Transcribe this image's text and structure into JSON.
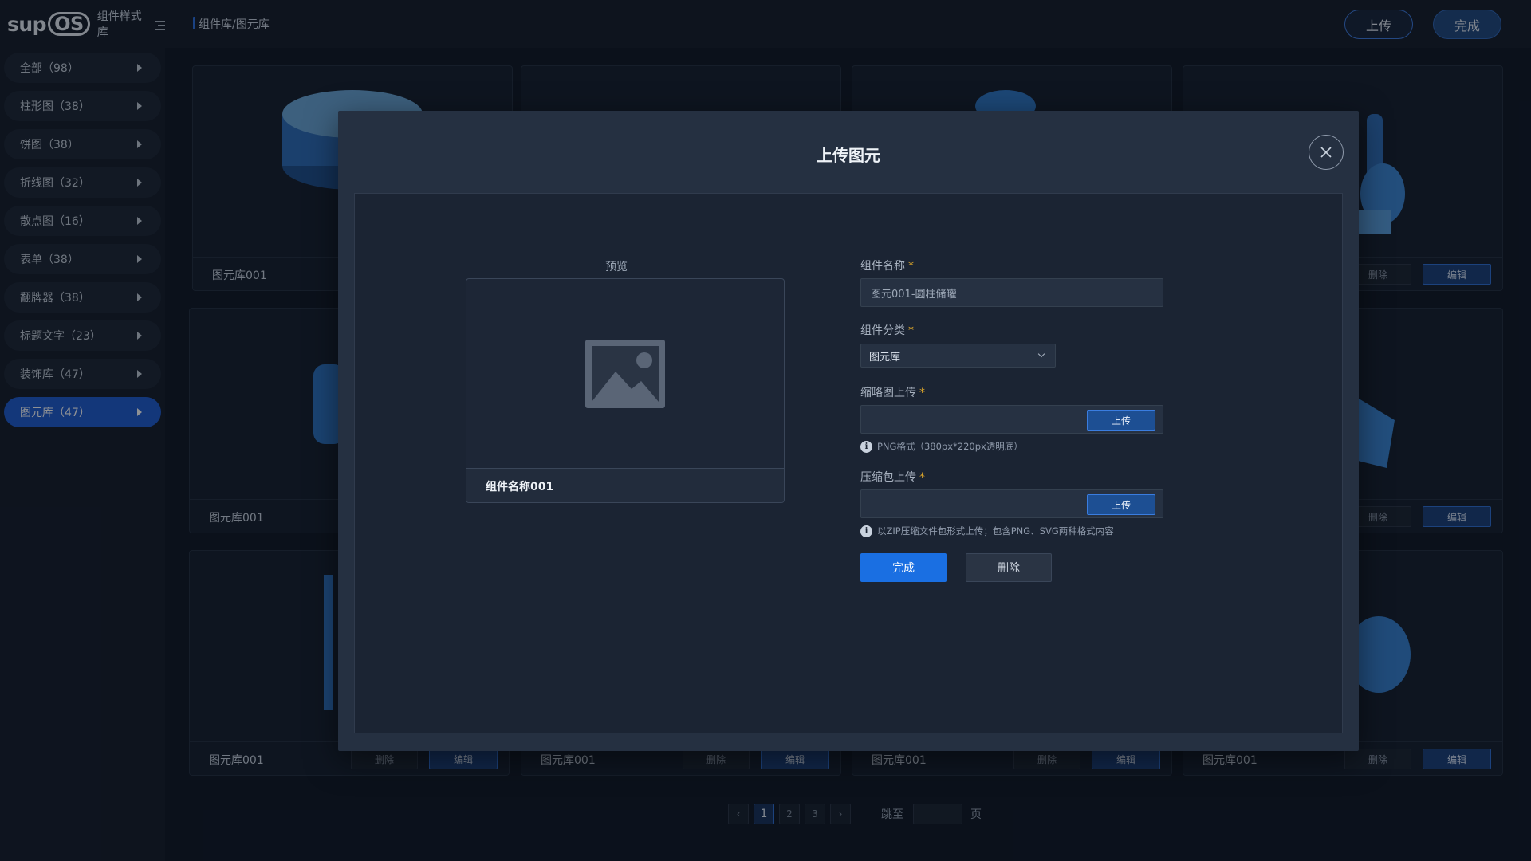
{
  "brand": {
    "logo_text": "sup",
    "logo_os": "OS",
    "name": "组件样式库"
  },
  "sidebar": {
    "items": [
      {
        "label": "全部（98）"
      },
      {
        "label": "柱形图（38）"
      },
      {
        "label": "饼图（38）"
      },
      {
        "label": "折线图（32）"
      },
      {
        "label": "散点图（16）"
      },
      {
        "label": "表单（38）"
      },
      {
        "label": "翻牌器（38）"
      },
      {
        "label": "标题文字（23）"
      },
      {
        "label": "装饰库（47）"
      },
      {
        "label": "图元库（47）"
      }
    ],
    "active_index": 9
  },
  "header": {
    "breadcrumb": "组件库/图元库",
    "upload_label": "上传",
    "done_label": "完成"
  },
  "grid": {
    "card_title": "图元库001",
    "delete_label": "删除",
    "edit_label": "编辑"
  },
  "pagination": {
    "pages": [
      "1",
      "2",
      "3"
    ],
    "current": "1",
    "jump_label": "跳至",
    "page_suffix": "页"
  },
  "modal": {
    "title": "上传图元",
    "preview_label": "预览",
    "preview_name": "组件名称001",
    "name_label": "组件名称",
    "name_value": "图元001-圆柱储罐",
    "category_label": "组件分类",
    "category_value": "图元库",
    "thumb_label": "缩略图上传",
    "thumb_button": "上传",
    "thumb_hint": "PNG格式（380px*220px透明底）",
    "zip_label": "压缩包上传",
    "zip_button": "上传",
    "zip_hint": "以ZIP压缩文件包形式上传；包含PNG、SVG两种格式内容",
    "required_mark": "*",
    "done_label": "完成",
    "delete_label": "删除"
  },
  "colors": {
    "accent": "#1a6fe2",
    "active_nav": "#1e5bd0",
    "background": "#0f1724",
    "modal": "#253041",
    "required": "#e0a92b"
  },
  "icons": [
    "menu-toggle-icon",
    "chevron-right-icon",
    "close-icon",
    "image-placeholder-icon",
    "info-icon",
    "chevron-down-icon",
    "chevron-left-icon"
  ]
}
